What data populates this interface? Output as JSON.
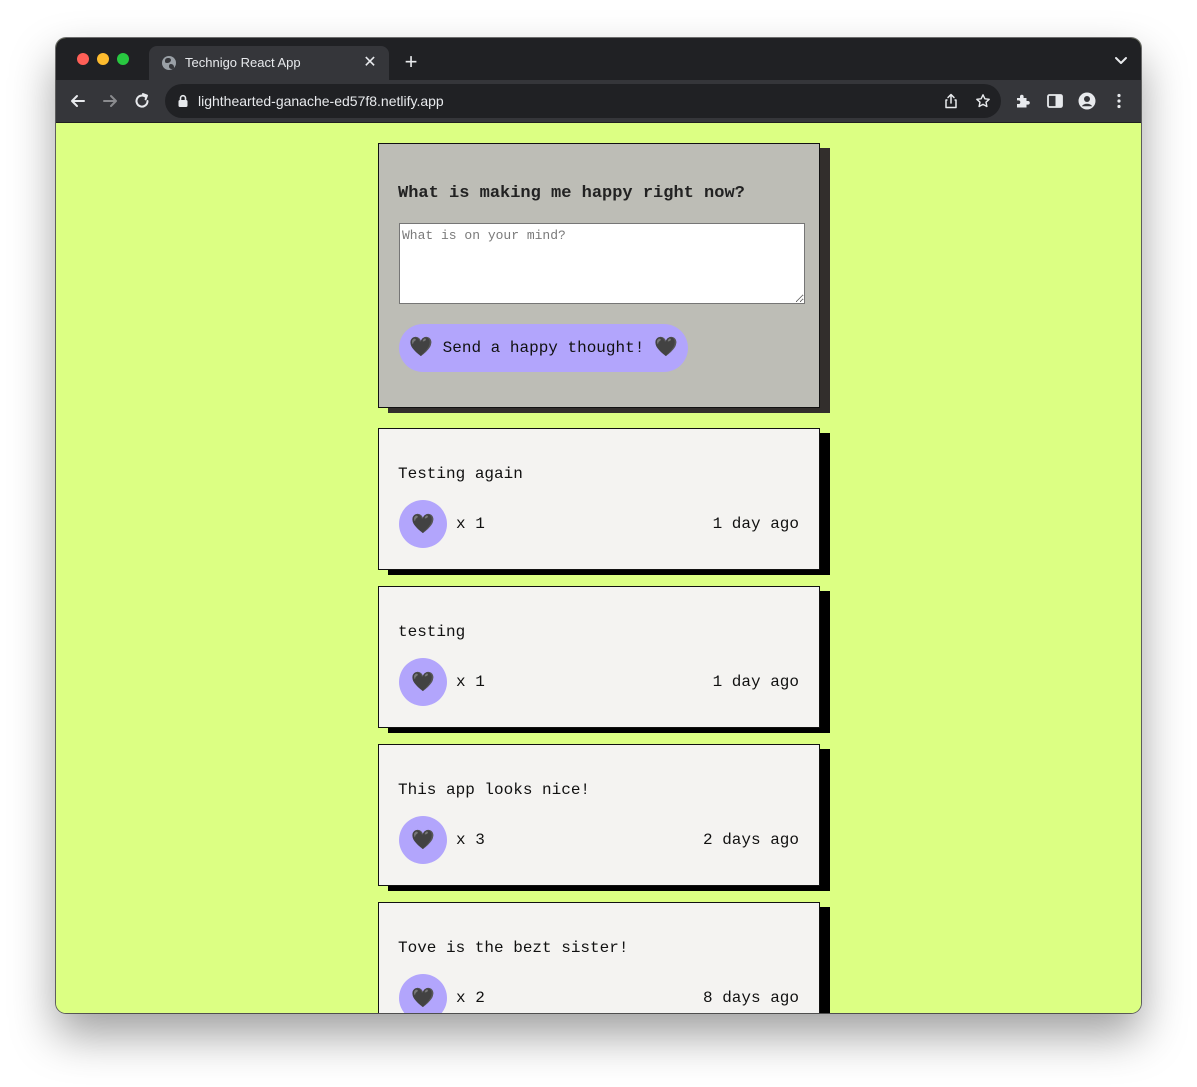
{
  "browser": {
    "tab_title": "Technigo React App",
    "url": "lighthearted-ganache-ed57f8.netlify.app"
  },
  "form": {
    "heading": "What is making me happy right now?",
    "placeholder": "What is on your mind?",
    "input_value": "",
    "send_label": "Send a happy thought!",
    "heart_icon": "🖤"
  },
  "thoughts": [
    {
      "message": "Testing again",
      "likes": "x 1",
      "time": "1 day ago"
    },
    {
      "message": "testing",
      "likes": "x 1",
      "time": "1 day ago"
    },
    {
      "message": "This app looks nice!",
      "likes": "x 3",
      "time": "2 days ago"
    },
    {
      "message": "Tove is the bezt sister!",
      "likes": "x 2",
      "time": "8 days ago"
    }
  ],
  "colors": {
    "page_background": "#dcff83",
    "accent_purple": "#b2a5fc",
    "form_card": "#bdbdb6",
    "thought_card": "#f4f3f1"
  }
}
